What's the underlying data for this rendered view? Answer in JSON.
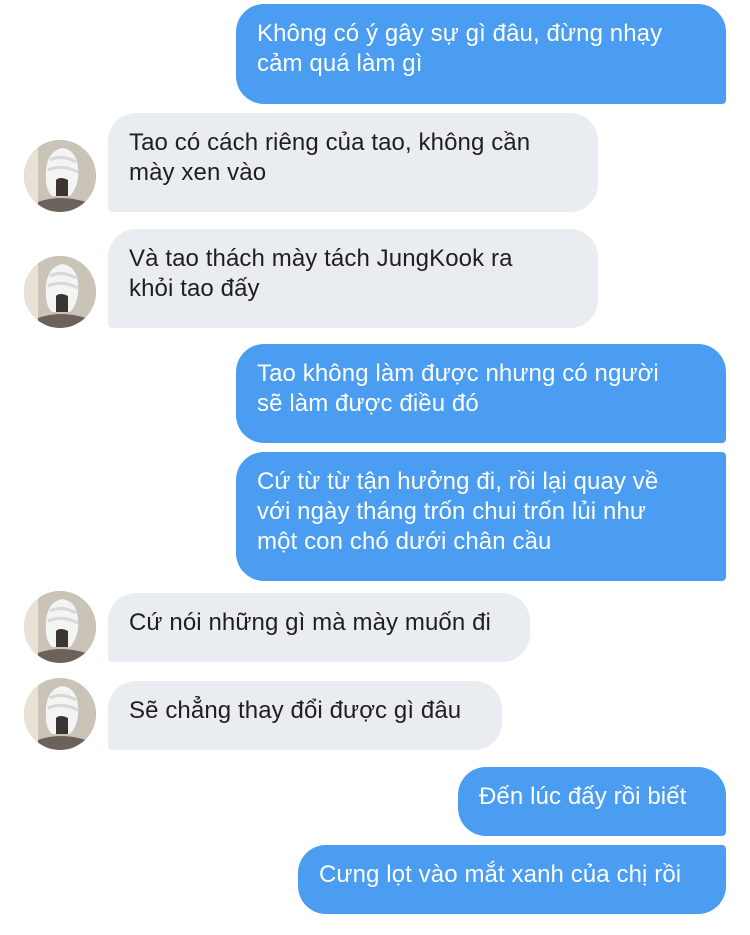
{
  "colors": {
    "outgoing_bubble": "#4a9df0",
    "incoming_bubble": "#e9ecf0",
    "outgoing_text": "#ffffff",
    "incoming_text": "#1f1f1f"
  },
  "messages": [
    {
      "direction": "outgoing",
      "lines": [
        "Không có ý gây sự gì đâu, đừng nhạy",
        "cảm quá làm gì"
      ]
    },
    {
      "direction": "incoming",
      "lines": [
        "Tao có cách riêng của tao, không cần",
        "mày xen vào"
      ],
      "avatar": "avatar-photo"
    },
    {
      "direction": "incoming",
      "lines": [
        "Và tao thách mày tách JungKook ra",
        "khỏi tao đấy"
      ],
      "avatar": "avatar-photo"
    },
    {
      "direction": "outgoing",
      "lines": [
        "Tao không làm được nhưng có người",
        "sẽ làm được điều đó"
      ]
    },
    {
      "direction": "outgoing",
      "lines": [
        "Cứ từ từ tận hưởng đi, rồi lại quay về",
        "với ngày tháng trốn chui trốn lủi như",
        "một con chó dưới chân cầu"
      ]
    },
    {
      "direction": "incoming",
      "lines": [
        "Cứ nói những gì mà mày muốn đi"
      ],
      "avatar": "avatar-photo"
    },
    {
      "direction": "incoming",
      "lines": [
        "Sẽ chẳng thay đổi được gì đâu"
      ],
      "avatar": "avatar-photo"
    },
    {
      "direction": "outgoing",
      "lines": [
        "Đến lúc đấy rồi biết"
      ]
    },
    {
      "direction": "outgoing",
      "lines": [
        "Cưng lọt vào mắt xanh của chị rồi"
      ]
    }
  ]
}
